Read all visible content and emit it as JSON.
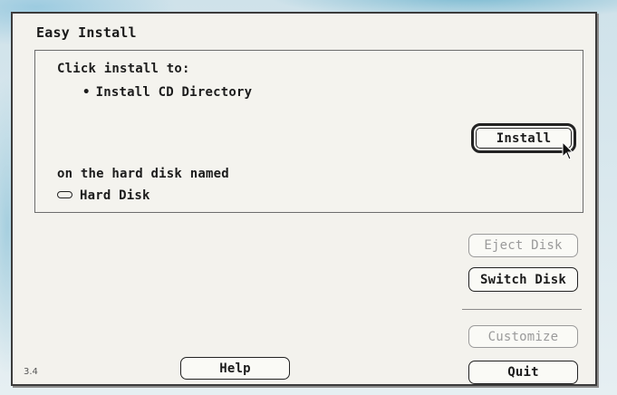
{
  "window": {
    "title": "Easy Install",
    "version": "3.4"
  },
  "panel": {
    "instruction": "Click install to:",
    "item": "Install CD Directory",
    "disk_prompt": "on the hard disk named",
    "disk_name": "Hard Disk"
  },
  "buttons": {
    "install": "Install",
    "eject_disk": "Eject Disk",
    "switch_disk": "Switch Disk",
    "customize": "Customize",
    "help": "Help",
    "quit": "Quit"
  },
  "icons": {
    "bullet": "•",
    "disk": "disk-icon",
    "cursor": "arrow-cursor-icon"
  }
}
